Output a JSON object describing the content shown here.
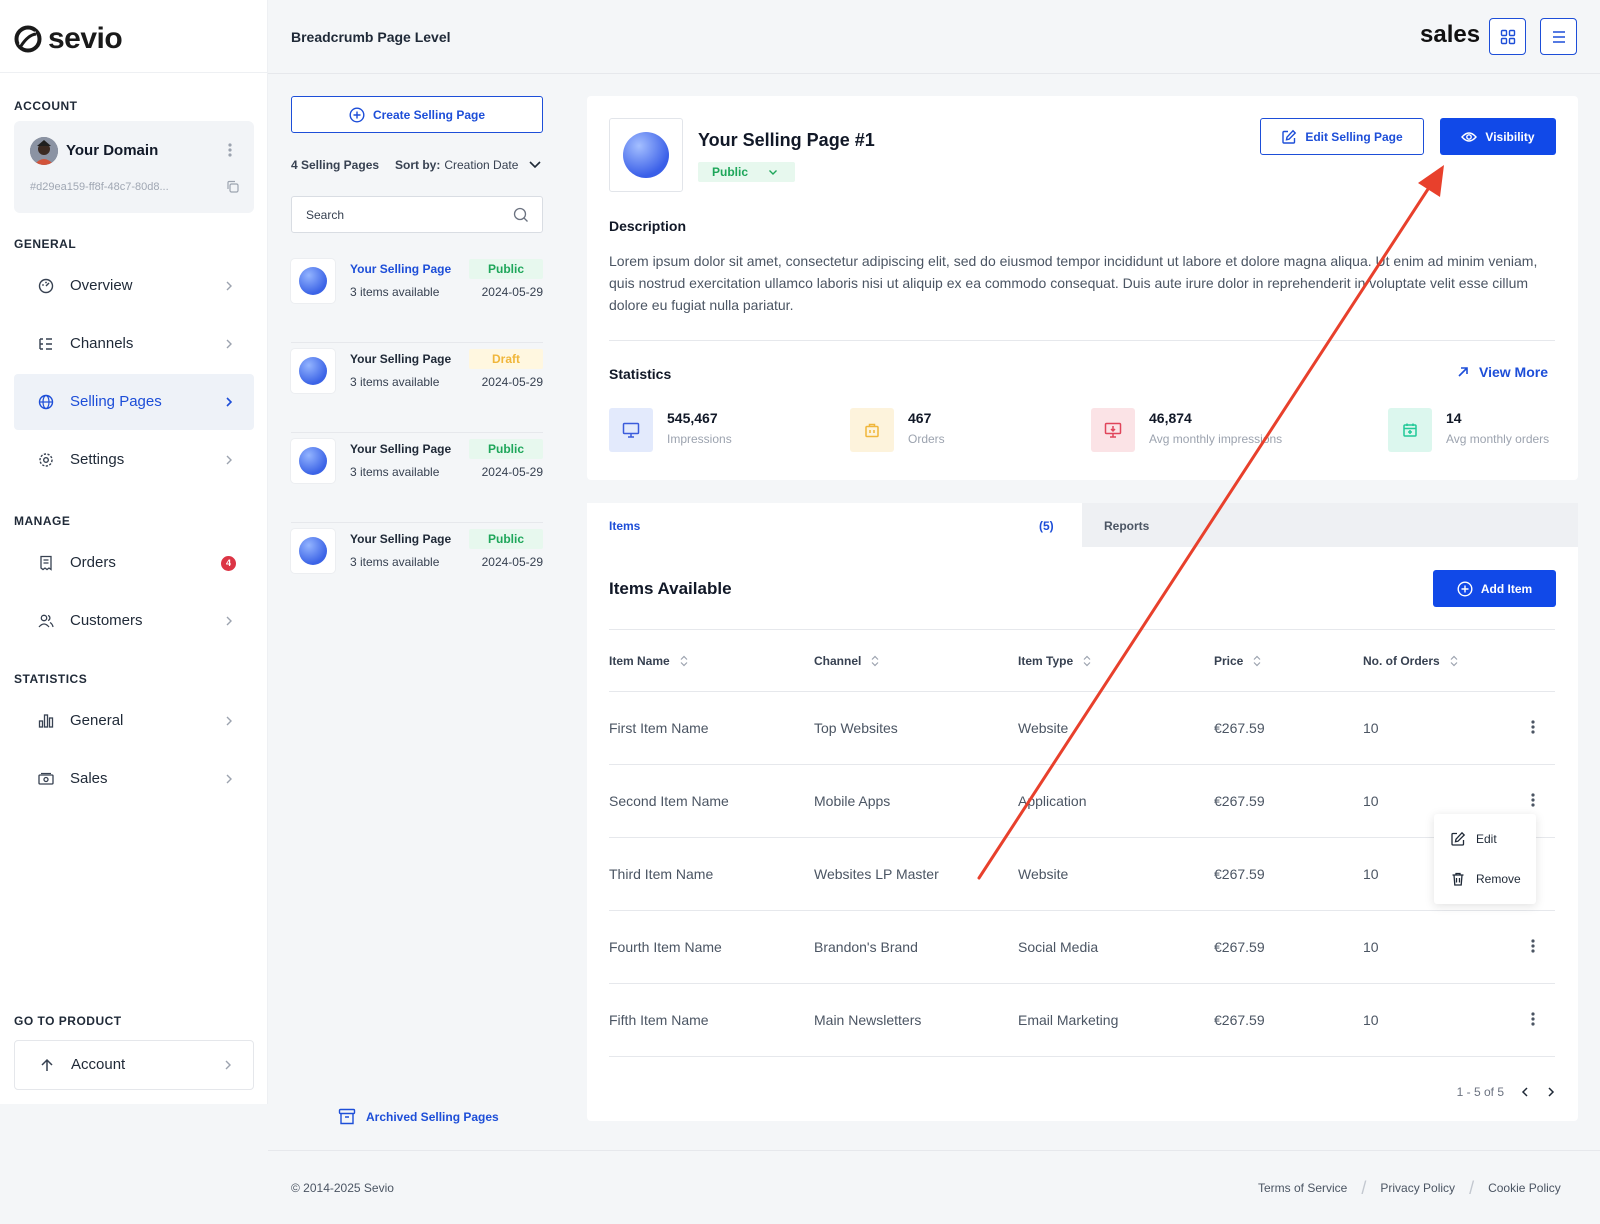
{
  "brand": {
    "logo_text": "sevio",
    "top_brand": "sales"
  },
  "topbar": {
    "breadcrumb": "Breadcrumb Page Level"
  },
  "sidebar": {
    "account_label": "ACCOUNT",
    "domain": {
      "name": "Your Domain",
      "id": "#d29ea159-ff8f-48c7-80d8..."
    },
    "general_label": "GENERAL",
    "general_items": [
      {
        "label": "Overview",
        "icon": "dashboard-icon"
      },
      {
        "label": "Channels",
        "icon": "list-tree-icon"
      },
      {
        "label": "Selling Pages",
        "icon": "globe-icon",
        "active": true
      },
      {
        "label": "Settings",
        "icon": "gear-icon"
      }
    ],
    "manage_label": "MANAGE",
    "manage_items": [
      {
        "label": "Orders",
        "icon": "receipt-icon",
        "badge": "4"
      },
      {
        "label": "Customers",
        "icon": "users-icon"
      }
    ],
    "statistics_label": "STATISTICS",
    "statistics_items": [
      {
        "label": "General",
        "icon": "bar-chart-icon"
      },
      {
        "label": "Sales",
        "icon": "cash-icon"
      }
    ],
    "goto_label": "GO TO PRODUCT",
    "goto_item": {
      "label": "Account",
      "icon": "arrow-up-icon"
    }
  },
  "middle": {
    "create_label": "Create Selling Page",
    "count_label": "4 Selling Pages",
    "sort_prefix": "Sort by:",
    "sort_value": "Creation Date",
    "search_placeholder": "Search",
    "pages": [
      {
        "title": "Your Selling Page",
        "sub": "3 items available",
        "status": "Public",
        "date": "2024-05-29",
        "selected": true
      },
      {
        "title": "Your Selling Page",
        "sub": "3 items available",
        "status": "Draft",
        "date": "2024-05-29"
      },
      {
        "title": "Your Selling Page",
        "sub": "3 items available",
        "status": "Public",
        "date": "2024-05-29"
      },
      {
        "title": "Your Selling Page",
        "sub": "3 items available",
        "status": "Public",
        "date": "2024-05-29"
      }
    ],
    "archived_label": "Archived Selling Pages"
  },
  "detail": {
    "title": "Your Selling Page #1",
    "visibility_status": "Public",
    "edit_label": "Edit Selling Page",
    "visibility_label": "Visibility",
    "description_heading": "Description",
    "description": "Lorem ipsum dolor sit amet, consectetur adipiscing elit, sed do eiusmod tempor incididunt ut labore et dolore magna aliqua. Ut enim ad minim veniam, quis nostrud exercitation ullamco laboris nisi ut aliquip ex ea commodo consequat. Duis aute irure dolor in reprehenderit in voluptate velit esse cillum dolore eu fugiat nulla pariatur.",
    "statistics_heading": "Statistics",
    "view_more": "View More",
    "stats": [
      {
        "value": "545,467",
        "label": "Impressions",
        "icon": "monitor-icon",
        "color": "#3b5bdb"
      },
      {
        "value": "467",
        "label": "Orders",
        "icon": "bag-icon",
        "color": "#f0b63a"
      },
      {
        "value": "46,874",
        "label": "Avg monthly impressions",
        "icon": "monitor-download-icon",
        "color": "#e0445a"
      },
      {
        "value": "14",
        "label": "Avg monthly orders",
        "icon": "calendar-icon",
        "color": "#20c997"
      }
    ]
  },
  "items": {
    "tab_items": "Items",
    "tab_count": "(5)",
    "tab_reports": "Reports",
    "title": "Items Available",
    "add_label": "Add Item",
    "columns": [
      "Item Name",
      "Channel",
      "Item Type",
      "Price",
      "No. of Orders"
    ],
    "rows": [
      {
        "name": "First Item Name",
        "channel": "Top Websites",
        "type": "Website",
        "price": "€267.59",
        "orders": "10"
      },
      {
        "name": "Second Item Name",
        "channel": "Mobile Apps",
        "type": "Application",
        "price": "€267.59",
        "orders": "10"
      },
      {
        "name": "Third Item Name",
        "channel": "Websites LP Master",
        "type": "Website",
        "price": "€267.59",
        "orders": "10"
      },
      {
        "name": "Fourth Item Name",
        "channel": "Brandon's Brand",
        "type": "Social Media",
        "price": "€267.59",
        "orders": "10"
      },
      {
        "name": "Fifth Item Name",
        "channel": "Main Newsletters",
        "type": "Email Marketing",
        "price": "€267.59",
        "orders": "10"
      }
    ],
    "menu": {
      "edit": "Edit",
      "remove": "Remove"
    },
    "pagination": "1 - 5 of 5"
  },
  "footer": {
    "copyright": "© 2014-2025 Sevio",
    "links": [
      "Terms of Service",
      "Privacy Policy",
      "Cookie Policy"
    ]
  },
  "colors": {
    "accent": "#1149e8",
    "annotation_arrow": "#e8402c"
  }
}
